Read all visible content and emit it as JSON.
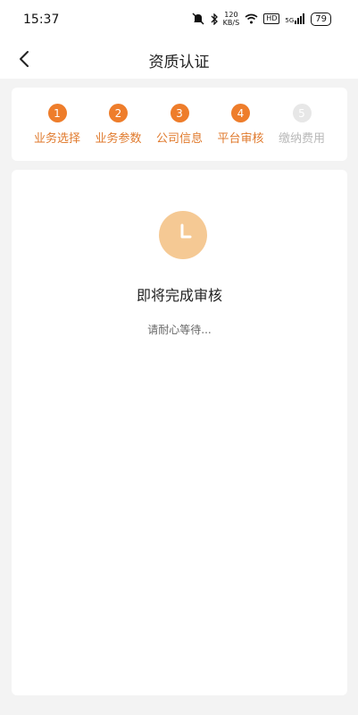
{
  "status_bar": {
    "time": "15:37",
    "speed_top": "120",
    "speed_bottom": "KB/S",
    "hd_label": "HD",
    "signal_label": "5G",
    "battery": "79"
  },
  "nav": {
    "title": "资质认证",
    "back_icon": "chevron-left-icon"
  },
  "steps": [
    {
      "num": "1",
      "label": "业务选择",
      "state": "done"
    },
    {
      "num": "2",
      "label": "业务参数",
      "state": "done"
    },
    {
      "num": "3",
      "label": "公司信息",
      "state": "done"
    },
    {
      "num": "4",
      "label": "平台审核",
      "state": "current"
    },
    {
      "num": "5",
      "label": "缴纳费用",
      "state": "pending"
    }
  ],
  "review": {
    "icon": "clock-icon",
    "title": "即将完成审核",
    "subtitle": "请耐心等待..."
  },
  "colors": {
    "accent": "#ee7d2b",
    "accent_text": "#e07a2d",
    "clock_bg": "#f5c994",
    "inactive": "#e7e7e7",
    "page_bg": "#f3f3f3"
  }
}
